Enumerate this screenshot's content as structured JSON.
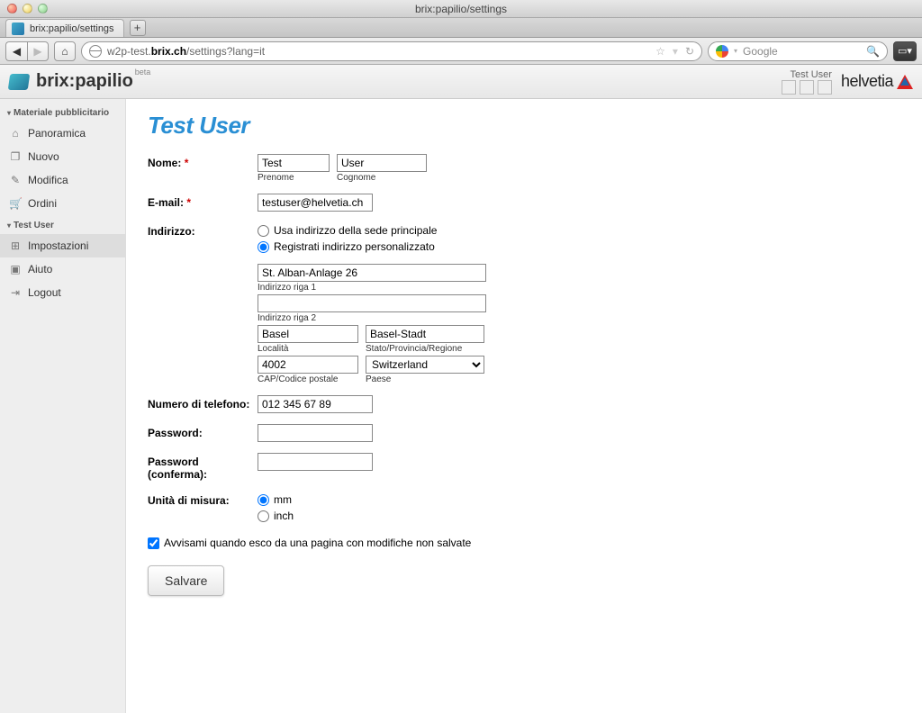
{
  "window_title": "brix:papilio/settings",
  "tab_label": "brix:papilio/settings",
  "url_display": "w2p-test.brix.ch/settings?lang=it",
  "url_bold": "brix.ch",
  "search_placeholder": "Google",
  "app": {
    "name": "brix:papilio",
    "badge": "beta"
  },
  "header_user": "Test User",
  "helvetia": "helvetia",
  "sidebar": {
    "group1": "Materiale pubblicitario",
    "items1": [
      {
        "label": "Panoramica",
        "icon": "⌂"
      },
      {
        "label": "Nuovo",
        "icon": "❐"
      },
      {
        "label": "Modifica",
        "icon": "✎"
      },
      {
        "label": "Ordini",
        "icon": "🛒"
      }
    ],
    "group2": "Test User",
    "items2": [
      {
        "label": "Impostazioni",
        "icon": "⊞"
      },
      {
        "label": "Aiuto",
        "icon": "▣"
      },
      {
        "label": "Logout",
        "icon": "⇥"
      }
    ]
  },
  "page_title": "Test User",
  "form": {
    "name_label": "Nome:",
    "firstname": "Test",
    "firstname_caption": "Prenome",
    "lastname": "User",
    "lastname_caption": "Cognome",
    "email_label": "E-mail:",
    "email": "testuser@helvetia.ch",
    "address_label": "Indirizzo:",
    "addr_opt1": "Usa indirizzo della sede principale",
    "addr_opt2": "Registrati indirizzo personalizzato",
    "addr1": "St. Alban-Anlage 26",
    "addr1_caption": "Indirizzo riga 1",
    "addr2": "",
    "addr2_caption": "Indirizzo riga 2",
    "city": "Basel",
    "city_caption": "Località",
    "state": "Basel-Stadt",
    "state_caption": "Stato/Provincia/Regione",
    "zip": "4002",
    "zip_caption": "CAP/Codice postale",
    "country": "Switzerland",
    "country_caption": "Paese",
    "phone_label": "Numero di telefono:",
    "phone": "012 345 67 89",
    "password_label": "Password:",
    "password2_label": "Password (conferma):",
    "unit_label": "Unità di misura:",
    "unit_mm": "mm",
    "unit_inch": "inch",
    "warn_on_leave": "Avvisami quando esco da una pagina con modifiche non salvate",
    "save": "Salvare"
  }
}
